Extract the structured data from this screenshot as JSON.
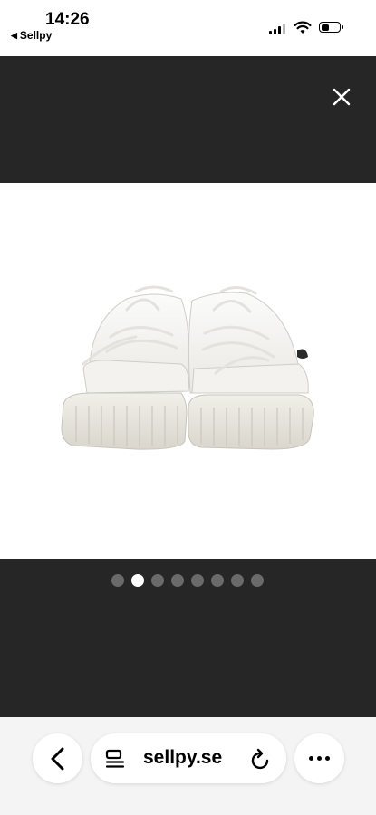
{
  "status_bar": {
    "time": "14:26",
    "back_app": "Sellpy",
    "signal_bars": 3,
    "battery_level": 0.45
  },
  "viewer": {
    "close_icon": "close-icon",
    "image": "white-sneakers-product-photo",
    "pagination": {
      "total": 8,
      "active_index": 1
    }
  },
  "browser": {
    "url": "sellpy.se",
    "icons": [
      "back-chevron-icon",
      "tabs-icon",
      "reload-icon",
      "more-icon"
    ]
  },
  "colors": {
    "viewer_background": "#262626",
    "dot_inactive": "#6a6a6a",
    "dot_active": "#ffffff",
    "toolbar_background": "#f4f4f4"
  }
}
